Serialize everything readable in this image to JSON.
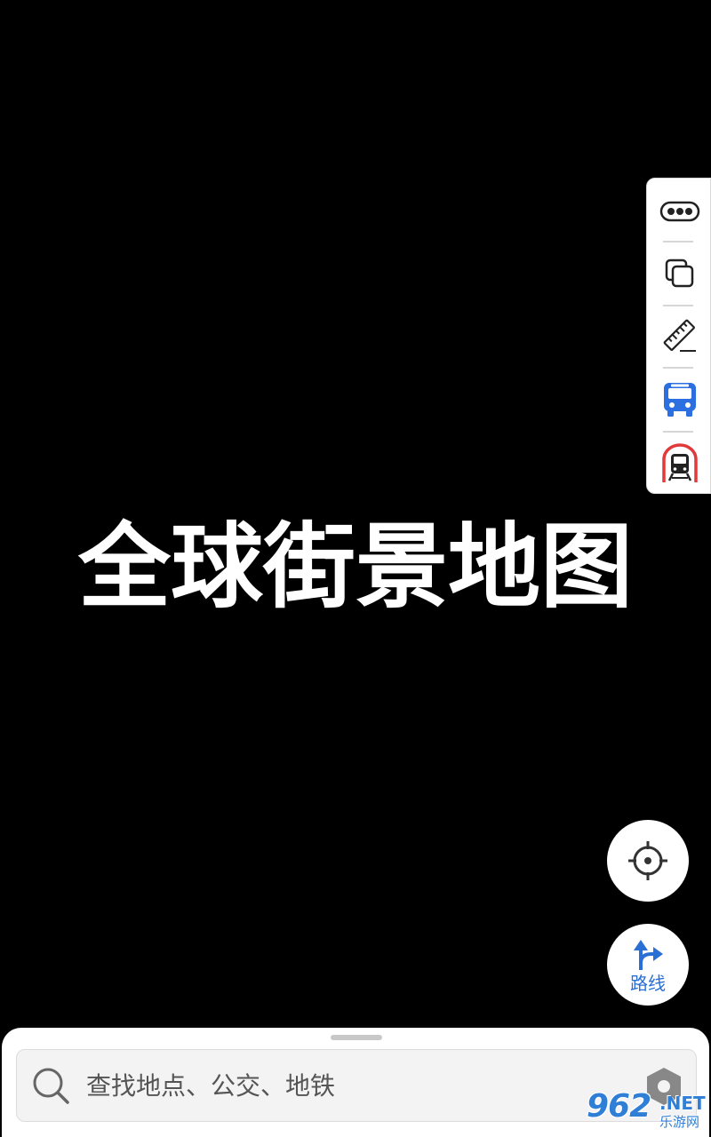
{
  "main": {
    "title": "全球街景地图"
  },
  "toolbar": {
    "items": [
      {
        "icon": "more-icon"
      },
      {
        "icon": "layers-icon"
      },
      {
        "icon": "ruler-icon"
      },
      {
        "icon": "bus-icon"
      },
      {
        "icon": "subway-icon"
      }
    ]
  },
  "controls": {
    "locate_icon": "crosshair-icon",
    "route_label": "路线",
    "route_icon": "route-arrow-icon"
  },
  "search": {
    "placeholder": "查找地点、公交、地铁"
  },
  "watermark": {
    "main": "962",
    "net": ".NET",
    "sub": "乐游网"
  },
  "colors": {
    "accent_blue": "#2a6fd6",
    "bus_blue": "#2b6fe0",
    "subway_red": "#e03a3a"
  }
}
